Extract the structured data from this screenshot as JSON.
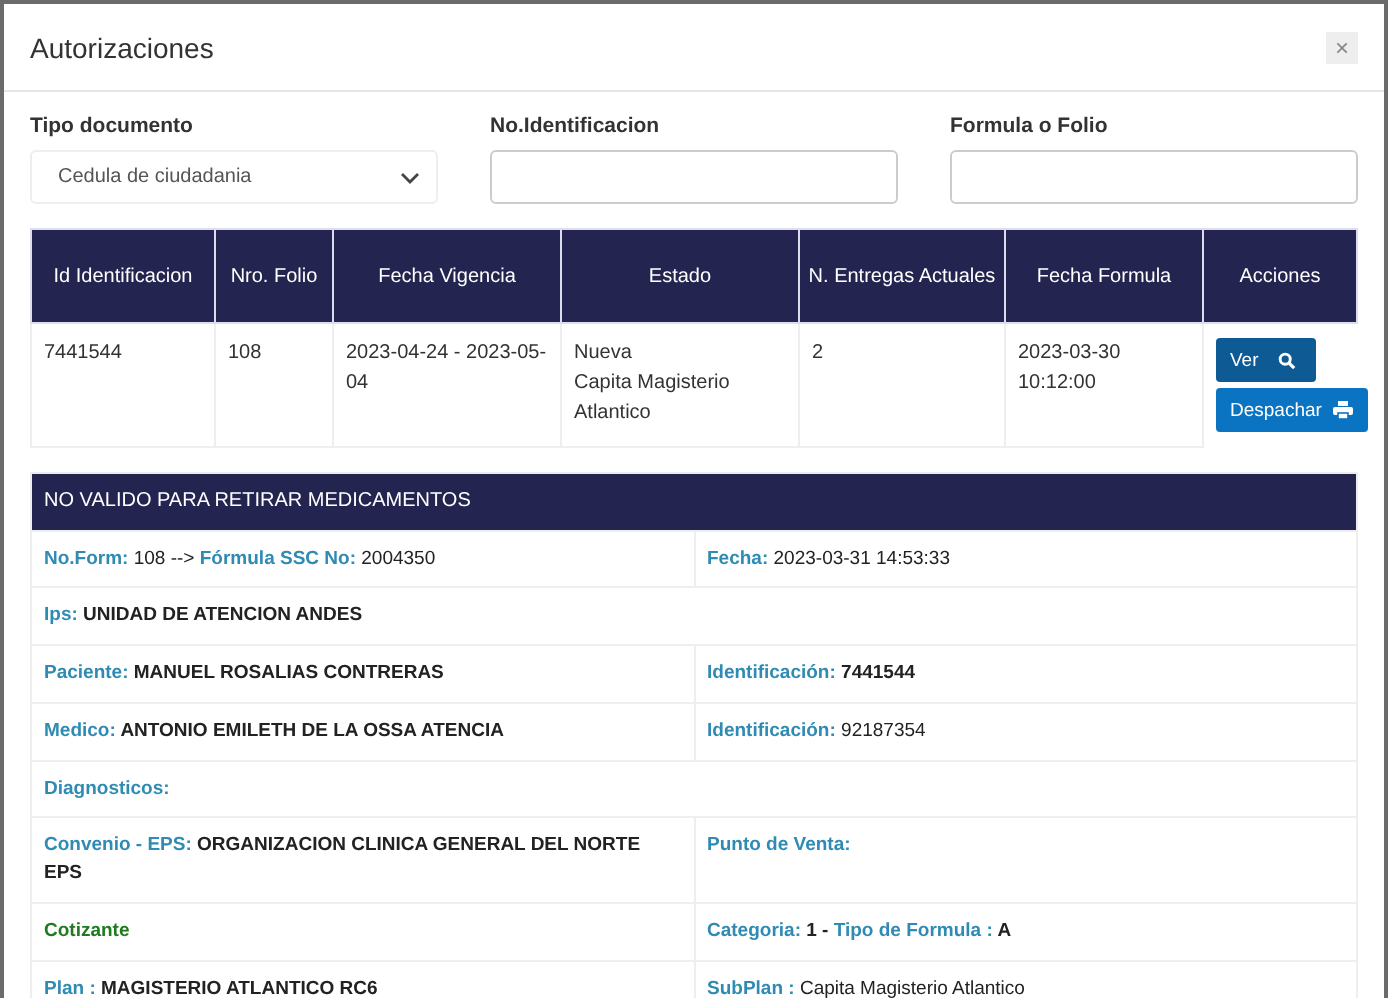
{
  "modal": {
    "title": "Autorizaciones",
    "close": "×"
  },
  "filters": [
    {
      "label": "Tipo documento",
      "kind": "select",
      "value": "Cedula de ciudadania"
    },
    {
      "label": "No.Identificacion",
      "kind": "input"
    },
    {
      "label": "Formula o Folio",
      "kind": "input"
    }
  ],
  "table": {
    "columns": [
      "Id Identificacion",
      "Nro. Folio",
      "Fecha Vigencia",
      "Estado",
      "N. Entregas Actuales",
      "Fecha Formula",
      "Acciones"
    ],
    "rows": [
      {
        "cells": [
          "7441544",
          "108",
          "2023-04-24 - 2023-05-04",
          "Nueva\nCapita Magisterio Atlantico",
          "2",
          "2023-03-30\n10:12:00"
        ],
        "actions": [
          {
            "label": "Ver",
            "kind": "dark"
          },
          {
            "label": "Despachar",
            "kind": "primary"
          }
        ]
      }
    ]
  },
  "detail": {
    "title": "NO VALIDO PARA RETIRAR MEDICAMENTOS",
    "rows": [
      [
        [
          {
            "kind": "label",
            "text": "No.Form:"
          },
          {
            "kind": "plain",
            "text": "108 -->"
          },
          {
            "kind": "label",
            "text": "Fórmula SSC No:"
          },
          {
            "kind": "plain",
            "text": "2004350"
          }
        ],
        [
          {
            "kind": "label",
            "text": "Fecha:"
          },
          {
            "kind": "plain",
            "text": "2023-03-31 14:53:33"
          }
        ]
      ],
      [
        [
          {
            "kind": "label",
            "text": "Ips:"
          },
          {
            "kind": "value",
            "text": "UNIDAD DE ATENCION ANDES"
          }
        ]
      ],
      [
        [
          {
            "kind": "label",
            "text": "Paciente:"
          },
          {
            "kind": "value",
            "text": "MANUEL ROSALIAS CONTRERAS"
          }
        ],
        [
          {
            "kind": "label",
            "text": "Identificación:"
          },
          {
            "kind": "value",
            "text": "7441544"
          }
        ]
      ],
      [
        [
          {
            "kind": "label",
            "text": "Medico:"
          },
          {
            "kind": "value",
            "text": "ANTONIO EMILETH DE LA OSSA ATENCIA"
          }
        ],
        [
          {
            "kind": "label",
            "text": "Identificación:"
          },
          {
            "kind": "plain",
            "text": "92187354"
          }
        ]
      ],
      [
        [
          {
            "kind": "label",
            "text": "Diagnosticos:"
          }
        ]
      ],
      [
        [
          {
            "kind": "label",
            "text": "Convenio - EPS:"
          },
          {
            "kind": "value",
            "text": "ORGANIZACION CLINICA GENERAL DEL NORTE EPS"
          }
        ],
        [
          {
            "kind": "label",
            "text": "Punto de Venta:"
          }
        ]
      ],
      [
        [
          {
            "kind": "status",
            "text": "Cotizante"
          }
        ],
        [
          {
            "kind": "label",
            "text": "Categoria:"
          },
          {
            "kind": "value",
            "text": "1 -"
          },
          {
            "kind": "label",
            "text": "Tipo de Formula :"
          },
          {
            "kind": "value",
            "text": "A"
          }
        ]
      ],
      [
        [
          {
            "kind": "label",
            "text": "Plan :"
          },
          {
            "kind": "value",
            "text": "MAGISTERIO ATLANTICO RC6"
          }
        ],
        [
          {
            "kind": "label",
            "text": "SubPlan :"
          },
          {
            "kind": "plain",
            "text": "Capita Magisterio Atlantico"
          }
        ]
      ]
    ]
  }
}
